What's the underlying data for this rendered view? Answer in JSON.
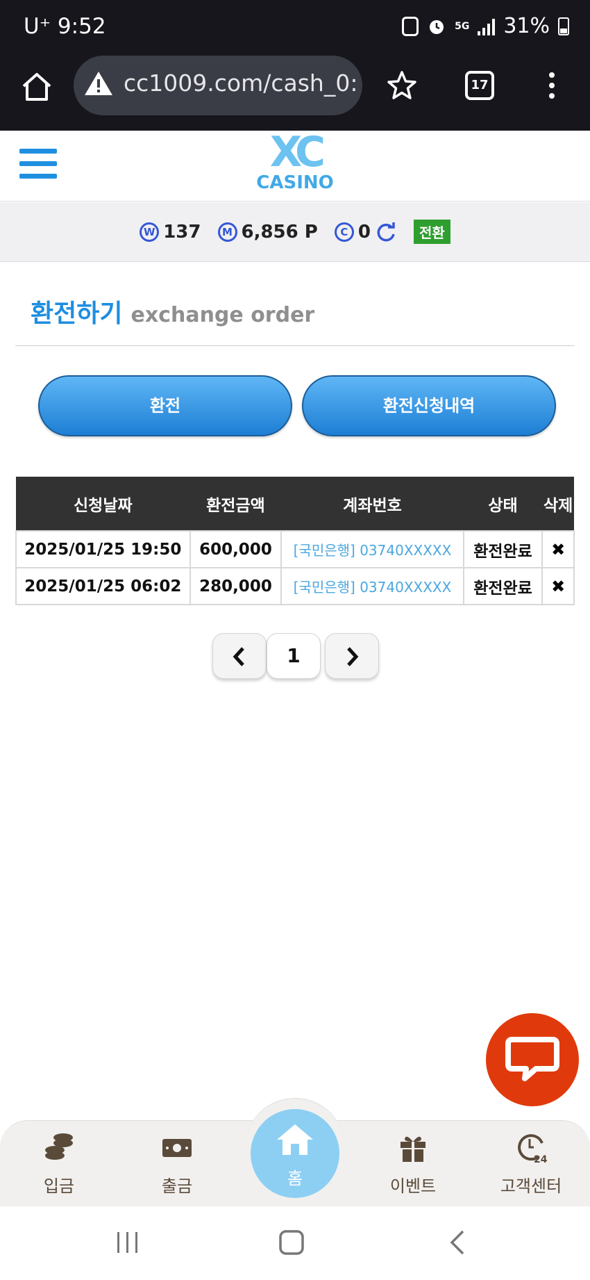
{
  "status_bar": {
    "carrier": "U⁺",
    "time": "9:52",
    "network": "5G",
    "battery": "31%"
  },
  "browser": {
    "url": "cc1009.com/cash_0:",
    "tab_count": "17"
  },
  "header": {
    "logo_mark": "XC",
    "logo_text": "CASINO"
  },
  "balance": {
    "w_icon": "W",
    "w_value": "137",
    "m_icon": "M",
    "m_value": "6,856 P",
    "c_icon": "C",
    "c_value": "0",
    "convert_label": "전환"
  },
  "page": {
    "title_ko": "환전하기",
    "title_en": "exchange order"
  },
  "actions": {
    "exchange_label": "환전",
    "history_label": "환전신청내역"
  },
  "table": {
    "columns": [
      "신청날짜",
      "환전금액",
      "계좌번호",
      "상태",
      "삭제"
    ],
    "rows": [
      {
        "date": "2025/01/25 19:50",
        "amount": "600,000",
        "account": "[국민은행] 03740XXXXX",
        "status": "환전완료",
        "delete": "✖"
      },
      {
        "date": "2025/01/25 06:02",
        "amount": "280,000",
        "account": "[국민은행] 03740XXXXX",
        "status": "환전완료",
        "delete": "✖"
      }
    ]
  },
  "pagination": {
    "prev": "‹",
    "current": "1",
    "next": "›"
  },
  "bottom_nav": {
    "deposit": "입금",
    "withdraw": "출금",
    "home": "홈",
    "event": "이벤트",
    "support": "고객센터"
  },
  "colors": {
    "accent": "#1e8ee0",
    "table_header": "#323232",
    "fab": "#e03a0c",
    "status_bar": "#16161c"
  }
}
